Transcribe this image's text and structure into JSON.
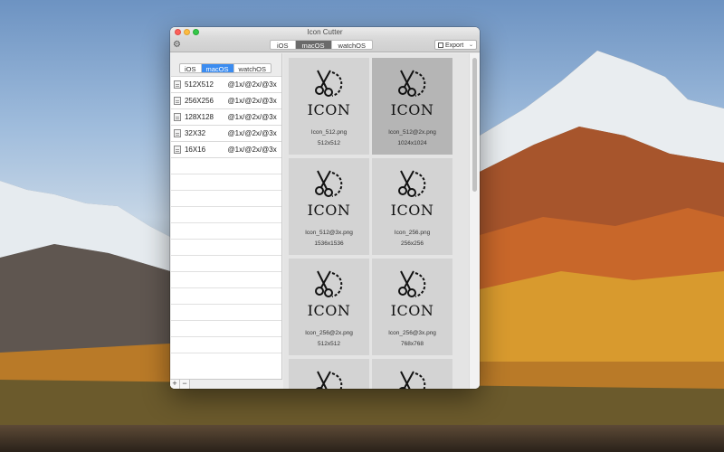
{
  "window": {
    "title": "Icon Cutter"
  },
  "toolbar": {
    "platform_tabs": [
      "iOS",
      "macOS",
      "watchOS"
    ],
    "active_tab": 1,
    "export_label": "Export"
  },
  "sidebar": {
    "platform_tabs": [
      "iOS",
      "macOS",
      "watchOS"
    ],
    "active_tab": 1,
    "sizes": [
      {
        "size": "512X512",
        "scales": "@1x/@2x/@3x"
      },
      {
        "size": "256X256",
        "scales": "@1x/@2x/@3x"
      },
      {
        "size": "128X128",
        "scales": "@1x/@2x/@3x"
      },
      {
        "size": "32X32",
        "scales": "@1x/@2x/@3x"
      },
      {
        "size": "16X16",
        "scales": "@1x/@2x/@3x"
      }
    ],
    "add_label": "+",
    "remove_label": "−"
  },
  "grid": {
    "icon_word": "ICON",
    "items": [
      {
        "file": "Icon_512.png",
        "dims": "512x512"
      },
      {
        "file": "Icon_512@2x.png",
        "dims": "1024x1024",
        "selected": true
      },
      {
        "file": "Icon_512@3x.png",
        "dims": "1536x1536"
      },
      {
        "file": "Icon_256.png",
        "dims": "256x256"
      },
      {
        "file": "Icon_256@2x.png",
        "dims": "512x512"
      },
      {
        "file": "Icon_256@3x.png",
        "dims": "768x768"
      },
      {
        "file": "",
        "dims": ""
      },
      {
        "file": "",
        "dims": ""
      }
    ]
  },
  "colors": {
    "accent_blue": "#3b8cf0",
    "selected_cell": "#b5b5b5",
    "cell": "#d3d3d3"
  }
}
